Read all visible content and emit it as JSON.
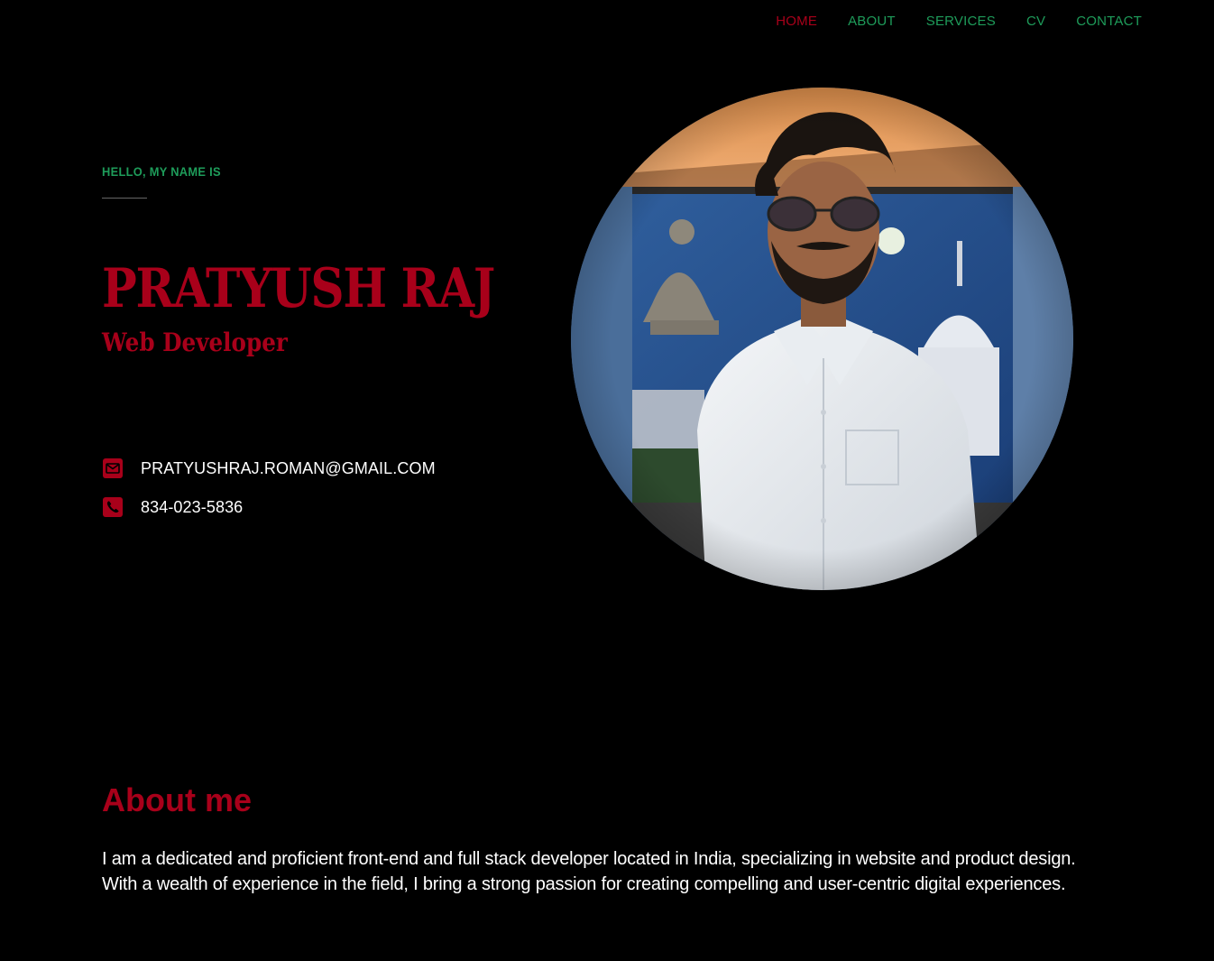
{
  "nav": {
    "items": [
      {
        "label": "HOME",
        "active": true
      },
      {
        "label": "ABOUT",
        "active": false
      },
      {
        "label": "SERVICES",
        "active": false
      },
      {
        "label": "CV",
        "active": false
      },
      {
        "label": "CONTACT",
        "active": false
      }
    ]
  },
  "hero": {
    "greeting": "HELLO, MY NAME IS",
    "name": "PRATYUSH RAJ",
    "role": "Web Developer",
    "email": "PRATYUSHRAJ.ROMAN@GMAIL.COM",
    "phone": "834-023-5836",
    "email_icon": "envelope-icon",
    "phone_icon": "phone-icon"
  },
  "about": {
    "title": "About me",
    "line1": "I am a dedicated and proficient front-end and full stack developer located in India, specializing in website and product design.",
    "line2": "With a wealth of experience in the field, I bring a strong passion for creating compelling and user-centric digital experiences."
  },
  "colors": {
    "background": "#000000",
    "accent_red": "#a8001a",
    "accent_green": "#1e9c5a",
    "text": "#ffffff"
  }
}
